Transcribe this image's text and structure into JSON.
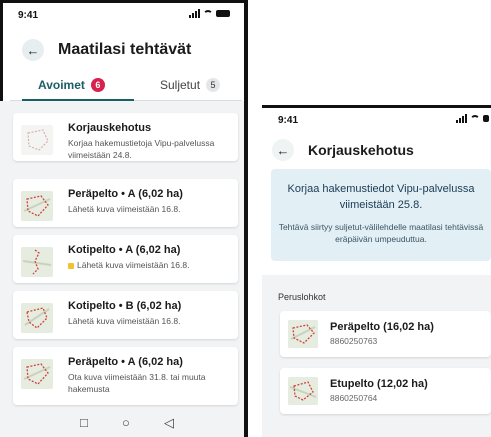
{
  "screen1": {
    "status": {
      "time": "9:41"
    },
    "header": {
      "title": "Maatilasi tehtävät"
    },
    "tabs": [
      {
        "label": "Avoimet",
        "count": "6"
      },
      {
        "label": "Suljetut",
        "count": "5"
      }
    ],
    "cards": [
      {
        "title": "Korjauskehotus",
        "subtitle": "Korjaa hakemustietoja Vipu-palvelussa viimeistään 24.8."
      },
      {
        "title": "Peräpelto • A (6,02 ha)",
        "subtitle": "Lähetä kuva viimeistään 16.8."
      },
      {
        "title": "Kotipelto • A (6,02 ha)",
        "subtitle": "Lähetä kuva viimeistään 16.8."
      },
      {
        "title": "Kotipelto • B (6,02 ha)",
        "subtitle": "Lähetä kuva viimeistään 16.8."
      },
      {
        "title": "Peräpelto • A (6,02 ha)",
        "subtitle": "Ota kuva viimeistään 31.8. tai muuta hakemusta"
      }
    ],
    "navbar": {
      "recents": "□",
      "home": "○",
      "back": "◁"
    }
  },
  "screen2": {
    "status": {
      "time": "9:41"
    },
    "header": {
      "title": "Korjauskehotus"
    },
    "notice": {
      "main": "Korjaa hakemustiedot Vipu-palvelussa viimeistään 25.8.",
      "sub": "Tehtävä siirtyy suljetut-välilehdelle maatilasi tehtävissä eräpäivän umpeuduttua."
    },
    "section_label": "Peruslohkot",
    "parcels": [
      {
        "title": "Peräpelto (16,02 ha)",
        "id": "8860250763"
      },
      {
        "title": "Etupelto (12,02 ha)",
        "id": "8860250764"
      }
    ]
  },
  "colors": {
    "accent": "#1a5e66",
    "badge_red": "#d8214f",
    "notice_bg": "#e2eff4",
    "warning_yellow": "#f1c232"
  },
  "icons": [
    "back-arrow-icon",
    "signal-icon",
    "wifi-icon",
    "battery-icon",
    "field-map-icon"
  ]
}
